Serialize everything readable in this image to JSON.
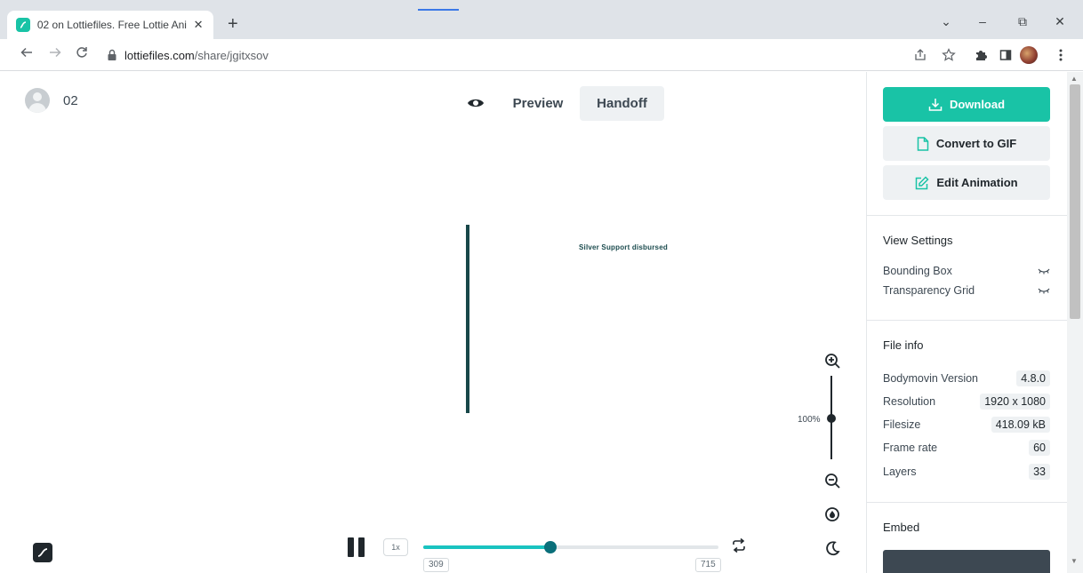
{
  "browser": {
    "tab_title": "02 on Lottiefiles. Free Lottie Anim",
    "tab_close": "✕",
    "new_tab": "+",
    "url_host": "lottiefiles.com",
    "url_path": "/share/jgitxsov",
    "window": {
      "minimize": "–",
      "maximize": "⧉",
      "close": "✕",
      "menu": "⌄"
    }
  },
  "header": {
    "animation_name": "02",
    "modes": {
      "preview": "Preview",
      "handoff": "Handoff",
      "active": "handoff"
    }
  },
  "canvas": {
    "label": "Silver Support disbursed",
    "zoom_label": "100%"
  },
  "player": {
    "speed": "1x",
    "frame_start": "309",
    "frame_end": "715",
    "progress": 0.43,
    "state": "playing"
  },
  "panel": {
    "download": "Download",
    "convert_gif": "Convert to GIF",
    "edit_animation": "Edit Animation",
    "view_settings": {
      "title": "View Settings",
      "items": [
        "Bounding Box",
        "Transparency Grid"
      ]
    },
    "file_info": {
      "title": "File info",
      "rows": [
        {
          "label": "Bodymovin Version",
          "value": "4.8.0"
        },
        {
          "label": "Resolution",
          "value": "1920 x 1080"
        },
        {
          "label": "Filesize",
          "value": "418.09 kB"
        },
        {
          "label": "Frame rate",
          "value": "60"
        },
        {
          "label": "Layers",
          "value": "33"
        }
      ]
    },
    "embed": {
      "title": "Embed"
    }
  },
  "colors": {
    "accent": "#19c3a6",
    "seek_fill": "#19c3c0",
    "seek_knob": "#0a6f7a",
    "animation_bar": "#184749"
  }
}
